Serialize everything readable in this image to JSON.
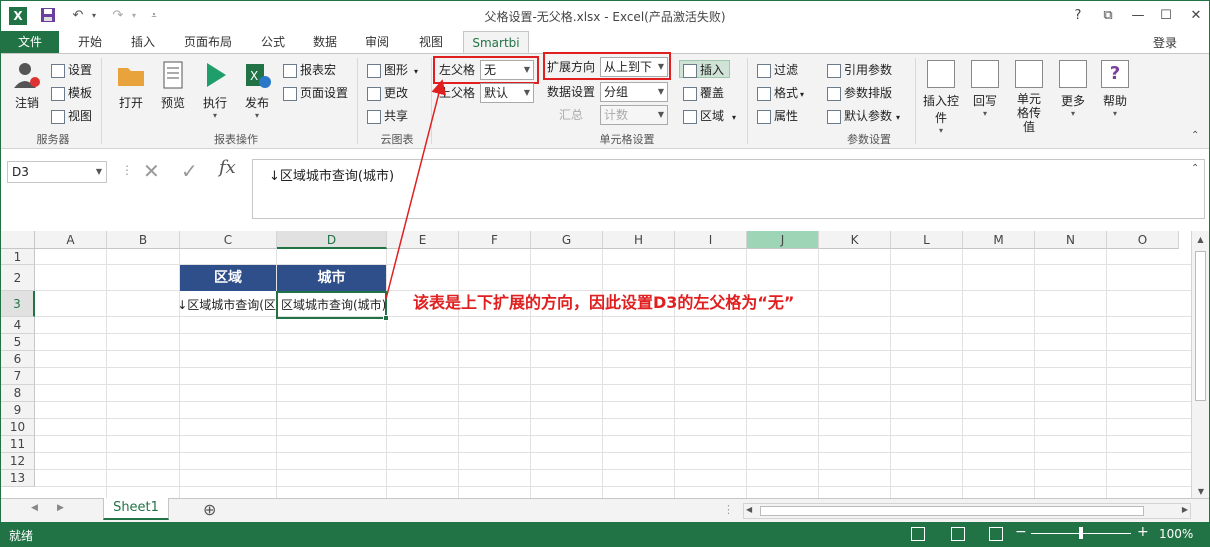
{
  "window": {
    "title": "父格设置-无父格.xlsx - Excel(产品激活失败)",
    "help": "?",
    "restore_ribbon": "⧉",
    "minimize": "—",
    "maximize": "☐",
    "close": "✕"
  },
  "tabs": [
    "文件",
    "开始",
    "插入",
    "页面布局",
    "公式",
    "数据",
    "审阅",
    "视图",
    "Smartbi"
  ],
  "login": "登录",
  "ribbon": {
    "server": {
      "group": "服务器",
      "logout": "注销",
      "settings": "设置",
      "template": "模板",
      "view": "视图"
    },
    "report_ops": {
      "group": "报表操作",
      "open": "打开",
      "preview": "预览",
      "execute": "执行",
      "publish": "发布",
      "macro": "报表宏",
      "page_setup": "页面设置"
    },
    "cloud": {
      "group": "云图表",
      "chart": "图形",
      "update": "更改",
      "share": "共享"
    },
    "cell_settings": {
      "group": "单元格设置",
      "left_parent_label": "左父格",
      "left_parent_value": "无",
      "top_parent_label": "上父格",
      "top_parent_value": "默认",
      "expand_dir_label": "扩展方向",
      "expand_dir_value": "从上到下",
      "data_setting_label": "数据设置",
      "data_setting_value": "分组",
      "summary_label": "汇总",
      "summary_value": "计数",
      "insert": "插入",
      "cover": "覆盖",
      "region": "区域"
    },
    "param": {
      "group": "参数设置",
      "filter": "过滤",
      "format": "格式",
      "property": "属性",
      "ref_param": "引用参数",
      "param_layout": "参数排版",
      "default_param": "默认参数"
    },
    "others": {
      "insert_ctrl": "插入控件",
      "writeback": "回写",
      "cell_value": "单元格传值",
      "more": "更多",
      "help": "帮助"
    }
  },
  "formula_bar": {
    "name_box": "D3",
    "formula": "↓区域城市查询(城市)"
  },
  "grid": {
    "columns": [
      "A",
      "B",
      "C",
      "D",
      "E",
      "F",
      "G",
      "H",
      "I",
      "J",
      "K",
      "L",
      "M",
      "N",
      "O"
    ],
    "rows": [
      "1",
      "2",
      "3",
      "4",
      "5",
      "6",
      "7",
      "8",
      "9",
      "10",
      "11",
      "12",
      "13"
    ],
    "header_c2": "区域",
    "header_d2": "城市",
    "cell_c3": "↓区域城市查询(区",
    "cell_d3": "区域城市查询(城市)",
    "annotation": "该表是上下扩展的方向，因此设置D3的左父格为“无”"
  },
  "sheet_tab": "Sheet1",
  "add_sheet": "⊕",
  "status": {
    "text": "就绪",
    "zoom": "100%"
  },
  "colors": {
    "accent": "#217346",
    "header_fill": "#2f4f8a",
    "annotation": "#e02020"
  }
}
